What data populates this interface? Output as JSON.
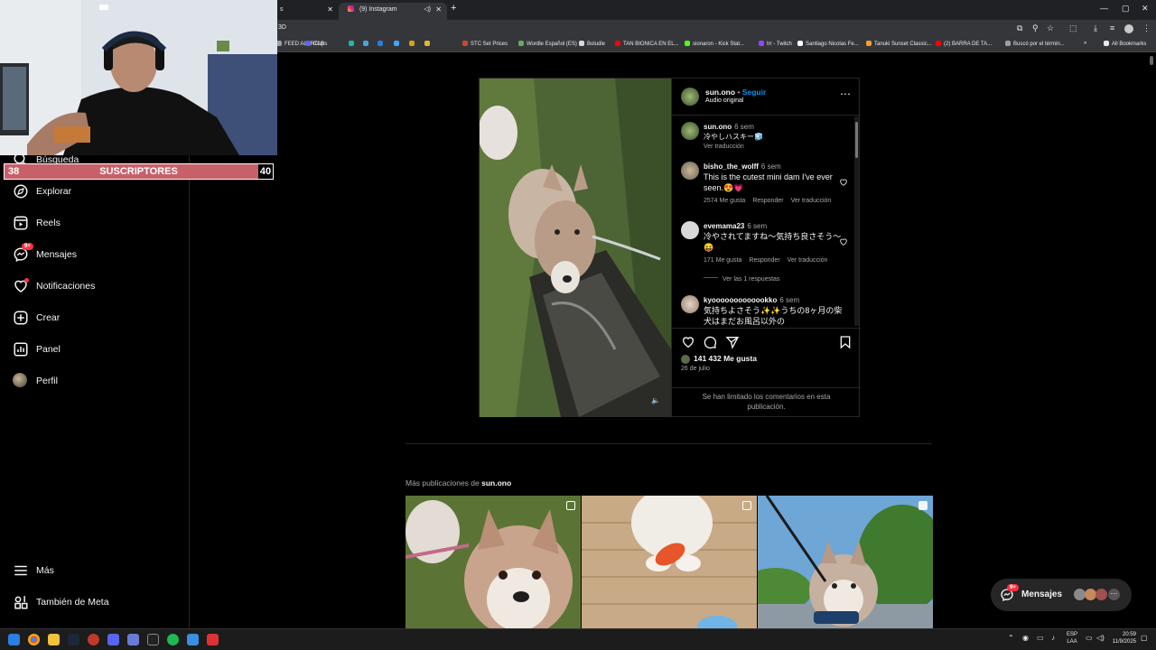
{
  "browser": {
    "tab_partial_label": "s",
    "tab_active_label": "(9) Instagram",
    "address_partial": "3D",
    "bookmarks": [
      {
        "label": "FEED ALERTAS",
        "color": "#9aa0a6"
      },
      {
        "label": "CLips",
        "color": "#5865f2"
      },
      {
        "label": "",
        "color": "#1fb6ad"
      },
      {
        "label": "",
        "color": "#4aa3df"
      },
      {
        "label": "",
        "color": "#2a7de1"
      },
      {
        "label": "",
        "color": "#3ea6ff"
      },
      {
        "label": "",
        "color": "#d4a21c"
      },
      {
        "label": "",
        "color": "#e0b832"
      },
      {
        "label": "STC Set Prices",
        "color": "#c94a2a"
      },
      {
        "label": "Wordle Español (ES)",
        "color": "#6aaa64"
      },
      {
        "label": "Boludle",
        "color": "#d9d9d9"
      },
      {
        "label": "TAN BIONICA EN EL...",
        "color": "#ff0000"
      },
      {
        "label": "sionaron - Kick Stat...",
        "color": "#53fc18"
      },
      {
        "label": "trr - Twitch",
        "color": "#9146ff"
      },
      {
        "label": "Santiago Nicolas Fe...",
        "color": "#ffffff"
      },
      {
        "label": "Tanuki Sunset Classic...",
        "color": "#f0a030"
      },
      {
        "label": "(2) BARRA DE TA...",
        "color": "#ff0000"
      },
      {
        "label": "Buscó por el términ...",
        "color": "#9aa0a6"
      }
    ],
    "all_bookmarks": "All Bookmarks"
  },
  "overlay": {
    "sub_left": "38",
    "sub_center": "SUSCRIPTORES",
    "sub_right": "40"
  },
  "sidebar": {
    "items": [
      {
        "label": "Búsqueda",
        "icon": "search-icon"
      },
      {
        "label": "Explorar",
        "icon": "compass-icon"
      },
      {
        "label": "Reels",
        "icon": "reels-icon"
      },
      {
        "label": "Mensajes",
        "icon": "messenger-icon",
        "badge": "9+"
      },
      {
        "label": "Notificaciones",
        "icon": "heart-icon"
      },
      {
        "label": "Crear",
        "icon": "plus-square-icon"
      },
      {
        "label": "Panel",
        "icon": "chart-icon"
      },
      {
        "label": "Perfil",
        "icon": "avatar"
      }
    ],
    "more": "Más",
    "meta": "También de Meta"
  },
  "post": {
    "username": "sun.ono",
    "dot": "•",
    "follow": "Seguir",
    "audio": "Audio original",
    "caption": {
      "user": "sun.ono",
      "time": "6 sem",
      "text": "冷やしハスキー🧊",
      "translate": "Ver traducción"
    },
    "comments": [
      {
        "user": "bisho_the_wolff",
        "time": "6 sem",
        "text": "This is the cutest mini dam I've ever seen.😍💗",
        "likes": "2574 Me gusta",
        "reply": "Responder",
        "translate": "Ver traducción"
      },
      {
        "user": "evemama23",
        "time": "6 sem",
        "text": "冷やされてますね〜気持ち良さそう〜😝",
        "likes": "171 Me gusta",
        "reply": "Responder",
        "translate": "Ver traducción",
        "replies": "Ver las 1 respuestas"
      },
      {
        "user": "kyooooooooooookko",
        "time": "6 sem",
        "text": "気持ちよさそう✨✨うちの8ヶ月の柴犬はまだお風呂以外の"
      }
    ],
    "likes": "141 432 Me gusta",
    "date": "26 de julio",
    "limited": "Se han limitado los comentarios en esta publicación."
  },
  "more": {
    "prefix": "Más publicaciones de",
    "user": "sun.ono"
  },
  "messages_pill": {
    "label": "Mensajes",
    "badge": "9+"
  },
  "taskbar": {
    "lang1": "ESP",
    "lang2": "LAA",
    "time": "20:59",
    "date": "11/9/2025"
  }
}
